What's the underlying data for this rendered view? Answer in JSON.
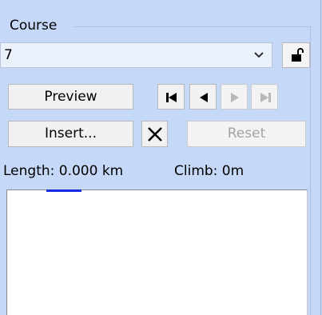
{
  "course_group": {
    "label": "Course"
  },
  "course_select": {
    "value": "7"
  },
  "buttons": {
    "preview": "Preview",
    "insert": "Insert...",
    "reset": "Reset"
  },
  "stats": {
    "length": "Length: 0.000 km",
    "climb": "Climb: 0m"
  },
  "icons": {
    "dropdown": "chevron-down-icon",
    "lock": "unlock-icon",
    "first": "skip-first-icon",
    "prev": "step-back-icon",
    "next": "step-forward-icon",
    "last": "skip-last-icon",
    "delete": "delete-x-icon"
  },
  "colors": {
    "panel_bg": "#c6d8f7",
    "button_disabled_text": "#a3a3a3",
    "course_marker": "#1b2be3"
  }
}
